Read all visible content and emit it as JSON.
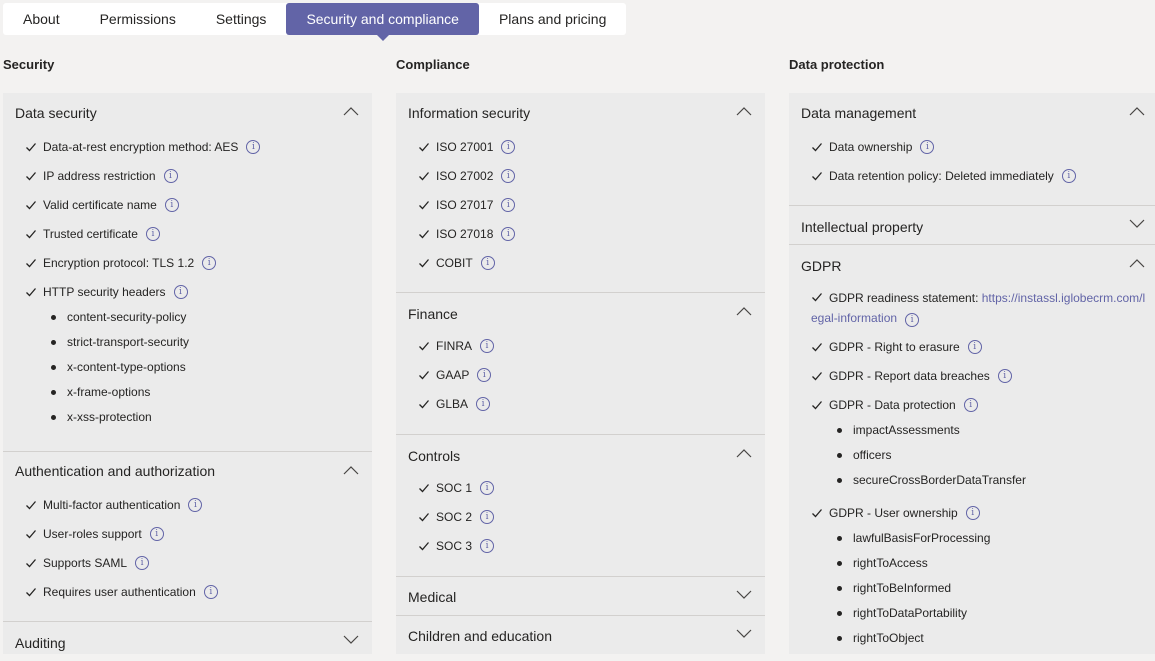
{
  "tabs": [
    "About",
    "Permissions",
    "Settings",
    "Security and compliance",
    "Plans and pricing"
  ],
  "active_tab": "Security and compliance",
  "security": {
    "title": "Security",
    "data_security": {
      "label": "Data security",
      "items": [
        "Data-at-rest encryption method: AES",
        "IP address restriction",
        "Valid certificate name",
        "Trusted certificate",
        "Encryption protocol: TLS 1.2",
        "HTTP security headers"
      ],
      "headers": [
        "content-security-policy",
        "strict-transport-security",
        "x-content-type-options",
        "x-frame-options",
        "x-xss-protection"
      ]
    },
    "auth": {
      "label": "Authentication and authorization",
      "items": [
        "Multi-factor authentication",
        "User-roles support",
        "Supports SAML",
        "Requires user authentication"
      ]
    },
    "auditing": {
      "label": "Auditing"
    }
  },
  "compliance": {
    "title": "Compliance",
    "infosec": {
      "label": "Information security",
      "items": [
        "ISO 27001",
        "ISO 27002",
        "ISO 27017",
        "ISO 27018",
        "COBIT"
      ]
    },
    "finance": {
      "label": "Finance",
      "items": [
        "FINRA",
        "GAAP",
        "GLBA"
      ]
    },
    "controls": {
      "label": "Controls",
      "items": [
        "SOC 1",
        "SOC 2",
        "SOC 3"
      ]
    },
    "medical": {
      "label": "Medical"
    },
    "children": {
      "label": "Children and education"
    }
  },
  "data_protection": {
    "title": "Data protection",
    "data_management": {
      "label": "Data management",
      "items": [
        "Data ownership",
        "Data retention policy: Deleted immediately"
      ]
    },
    "ip": {
      "label": "Intellectual property"
    },
    "gdpr": {
      "label": "GDPR",
      "readiness_prefix": "GDPR readiness statement: ",
      "readiness_link": "https://instassl.iglobecrm.com/legal-information",
      "items": [
        "GDPR - Right to erasure",
        "GDPR - Report data breaches",
        "GDPR - Data protection"
      ],
      "data_protection_subitems": [
        "impactAssessments",
        "officers",
        "secureCrossBorderDataTransfer"
      ],
      "user_ownership": "GDPR - User ownership",
      "user_ownership_subitems": [
        "lawfulBasisForProcessing",
        "rightToAccess",
        "rightToBeInformed",
        "rightToDataPortability",
        "rightToObject"
      ]
    }
  },
  "info_glyph": "i",
  "colors": {
    "accent": "#6264a7",
    "panel_bg": "#ebebeb",
    "page_bg": "#f3f2f1"
  }
}
